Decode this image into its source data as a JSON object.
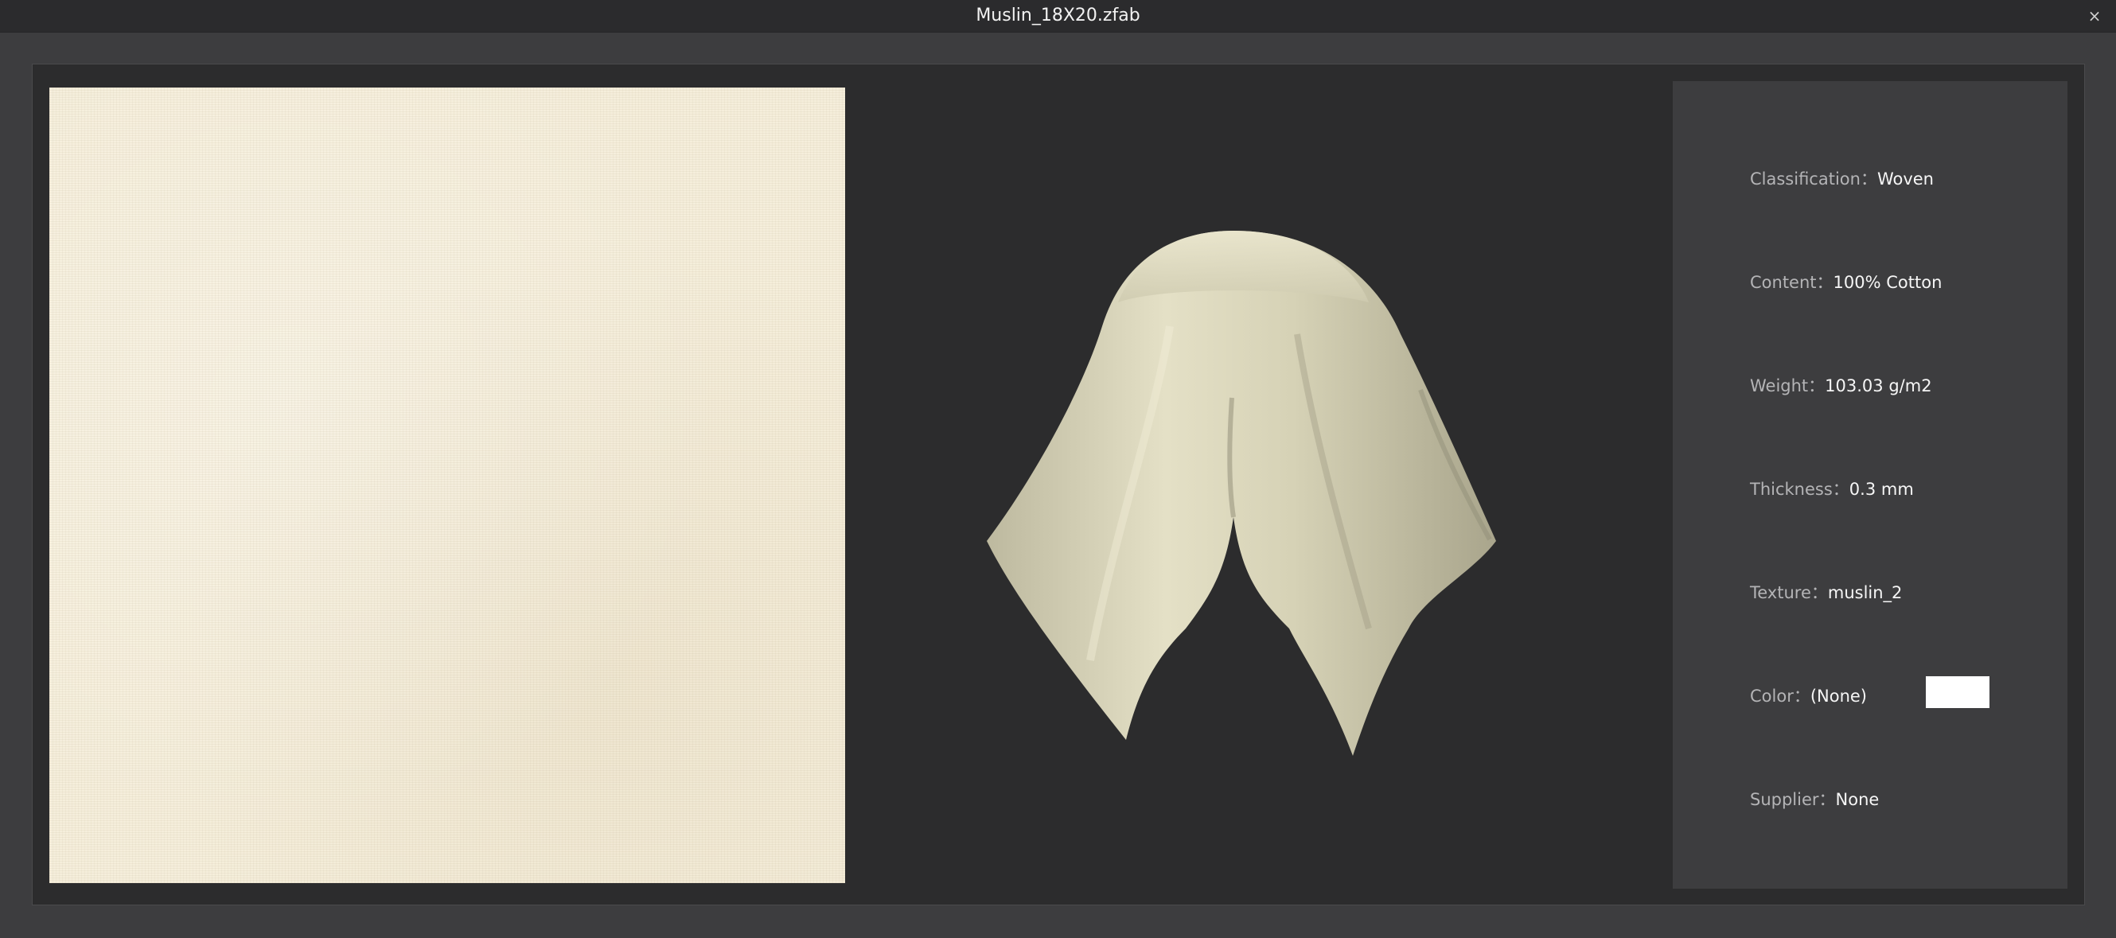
{
  "window": {
    "title": "Muslin_18X20.zfab",
    "close_glyph": "×"
  },
  "properties": [
    {
      "label": "Classification：",
      "value": "Woven"
    },
    {
      "label": "Content：",
      "value": "100% Cotton"
    },
    {
      "label": "Weight：",
      "value": "103.03 g/m2"
    },
    {
      "label": "Thickness：",
      "value": "0.3 mm"
    },
    {
      "label": "Texture：",
      "value": "muslin_2"
    },
    {
      "label": "Color：",
      "value": "(None)"
    },
    {
      "label": "Supplier：",
      "value": "None"
    }
  ],
  "colors": {
    "fabric": "#f5eedb",
    "color_chip": "#ffffff"
  },
  "icons": {
    "close": "close-icon"
  }
}
